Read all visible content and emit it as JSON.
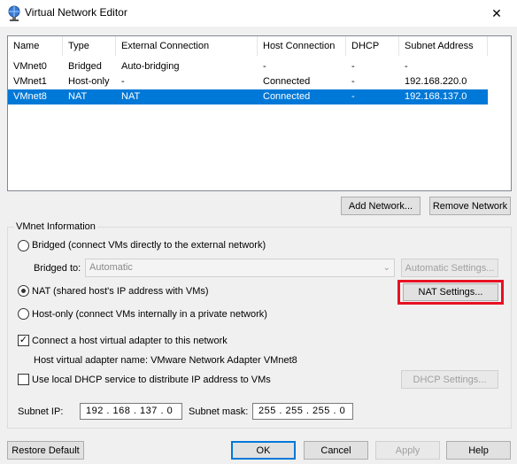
{
  "window": {
    "title": "Virtual Network Editor",
    "close_glyph": "✕"
  },
  "network_list": {
    "columns": [
      "Name",
      "Type",
      "External Connection",
      "Host Connection",
      "DHCP",
      "Subnet Address"
    ],
    "rows": [
      {
        "name": "VMnet0",
        "type": "Bridged",
        "external": "Auto-bridging",
        "host": "-",
        "dhcp": "-",
        "subnet": "-",
        "selected": false
      },
      {
        "name": "VMnet1",
        "type": "Host-only",
        "external": "-",
        "host": "Connected",
        "dhcp": "-",
        "subnet": "192.168.220.0",
        "selected": false
      },
      {
        "name": "VMnet8",
        "type": "NAT",
        "external": "NAT",
        "host": "Connected",
        "dhcp": "-",
        "subnet": "192.168.137.0",
        "selected": true
      }
    ]
  },
  "list_buttons": {
    "add_network": "Add Network...",
    "remove_network": "Remove Network"
  },
  "vmnet_info": {
    "group_label": "VMnet Information",
    "bridged_label": "Bridged (connect VMs directly to the external network)",
    "bridged_to_label": "Bridged to:",
    "bridged_to_value": "Automatic",
    "automatic_settings": "Automatic Settings...",
    "nat_label": "NAT (shared host's IP address with VMs)",
    "nat_settings": "NAT Settings...",
    "hostonly_label": "Host-only (connect VMs internally in a private network)",
    "selected_mode": "nat",
    "connect_adapter_label": "Connect a host virtual adapter to this network",
    "connect_adapter_checked": true,
    "adapter_name_text": "Host virtual adapter name: VMware Network Adapter VMnet8",
    "dhcp_label": "Use local DHCP service to distribute IP address to VMs",
    "dhcp_checked": false,
    "dhcp_settings": "DHCP Settings...",
    "subnet_ip_label": "Subnet IP:",
    "subnet_ip_value": "192 . 168 . 137 .  0",
    "subnet_mask_label": "Subnet mask:",
    "subnet_mask_value": "255 . 255 . 255 .  0"
  },
  "footer": {
    "restore_default": "Restore Default",
    "ok": "OK",
    "cancel": "Cancel",
    "apply": "Apply",
    "help": "Help"
  },
  "colors": {
    "selection": "#0078d7",
    "highlight_box": "#e81123"
  }
}
